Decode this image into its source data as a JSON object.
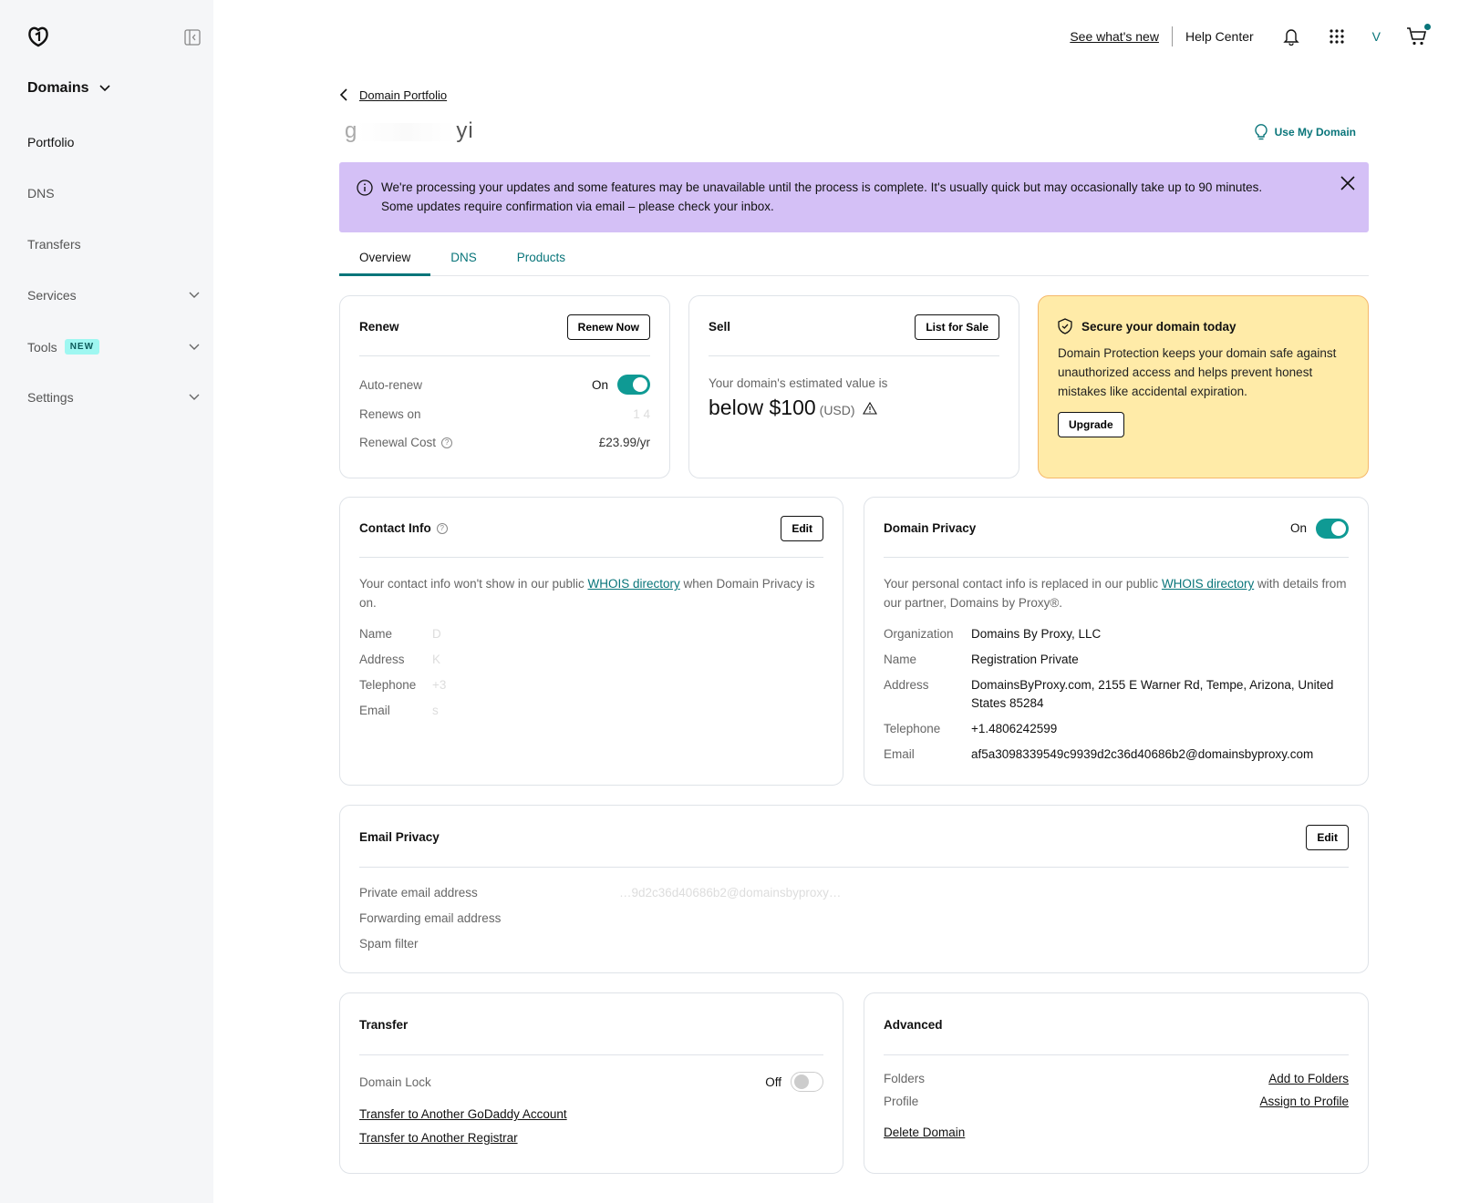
{
  "sidebar": {
    "section": "Domains",
    "items": [
      {
        "label": "Portfolio",
        "active": true
      },
      {
        "label": "DNS"
      },
      {
        "label": "Transfers"
      },
      {
        "label": "Services",
        "expandable": true
      },
      {
        "label": "Tools",
        "badge": "NEW",
        "expandable": true
      },
      {
        "label": "Settings",
        "expandable": true
      }
    ]
  },
  "topbar": {
    "whats_new": "See what's new",
    "help_center": "Help Center",
    "avatar_initial": "V",
    "icons": [
      "bell-icon",
      "apps-grid-icon",
      "cart-icon"
    ]
  },
  "header": {
    "back_label": "Domain Portfolio",
    "domain_name_start": "g",
    "domain_name_end": "yi",
    "use_my_domain": "Use My Domain"
  },
  "banner": {
    "line1": "We're processing your updates and some features may be unavailable until the process is complete. It's usually quick but may occasionally take up to 90 minutes.",
    "line2": "Some updates require confirmation via email – please check your inbox.",
    "color": "#d4c0f6"
  },
  "tabs": [
    {
      "label": "Overview",
      "active": true
    },
    {
      "label": "DNS"
    },
    {
      "label": "Products"
    }
  ],
  "renew": {
    "title": "Renew",
    "button": "Renew Now",
    "auto_renew_label": "Auto-renew",
    "auto_renew_state": "On",
    "renews_on_label": "Renews on",
    "renews_on_value": "1          4",
    "cost_label": "Renewal Cost",
    "cost_value": "£23.99/yr"
  },
  "sell": {
    "title": "Sell",
    "button": "List for Sale",
    "estimate_label": "Your domain's estimated value is",
    "estimate_value": "below $100",
    "currency": "(USD)"
  },
  "promo": {
    "title": "Secure your domain today",
    "body": "Domain Protection keeps your domain safe against unauthorized access and helps prevent honest mistakes like accidental expiration.",
    "button": "Upgrade",
    "bg_color": "#ffeba8"
  },
  "contact": {
    "title": "Contact Info",
    "button": "Edit",
    "desc_before": "Your contact info won't show in our public ",
    "desc_link": "WHOIS directory",
    "desc_after": " when Domain Privacy is on.",
    "fields": [
      {
        "label": "Name",
        "value": "D"
      },
      {
        "label": "Address",
        "value": "K"
      },
      {
        "label": "Telephone",
        "value": "+3"
      },
      {
        "label": "Email",
        "value": "s"
      }
    ]
  },
  "privacy": {
    "title": "Domain Privacy",
    "state": "On",
    "desc_before": "Your personal contact info is replaced in our public ",
    "desc_link": "WHOIS directory",
    "desc_after": " with details from our partner, Domains by Proxy®.",
    "fields": [
      {
        "label": "Organization",
        "value": "Domains By Proxy, LLC"
      },
      {
        "label": "Name",
        "value": "Registration Private"
      },
      {
        "label": "Address",
        "value": "DomainsByProxy.com, 2155 E Warner Rd, Tempe, Arizona, United States 85284"
      },
      {
        "label": "Telephone",
        "value": "+1.4806242599"
      },
      {
        "label": "Email",
        "value": "af5a3098339549c9939d2c36d40686b2@domainsbyproxy.com"
      }
    ]
  },
  "email_privacy": {
    "title": "Email Privacy",
    "button": "Edit",
    "fields": [
      {
        "label": "Private email address",
        "value": "…9d2c36d40686b2@domainsbyproxy…"
      },
      {
        "label": "Forwarding email address",
        "value": ""
      },
      {
        "label": "Spam filter",
        "value": ""
      }
    ]
  },
  "transfer": {
    "title": "Transfer",
    "lock_label": "Domain Lock",
    "lock_state": "Off",
    "link1": "Transfer to Another GoDaddy Account",
    "link2": "Transfer to Another Registrar"
  },
  "advanced": {
    "title": "Advanced",
    "folders_label": "Folders",
    "folders_action": "Add to Folders",
    "profile_label": "Profile",
    "profile_action": "Assign to Profile",
    "delete": "Delete Domain"
  },
  "colors": {
    "accent": "#09757a",
    "toggle_on": "#0f9a94"
  }
}
